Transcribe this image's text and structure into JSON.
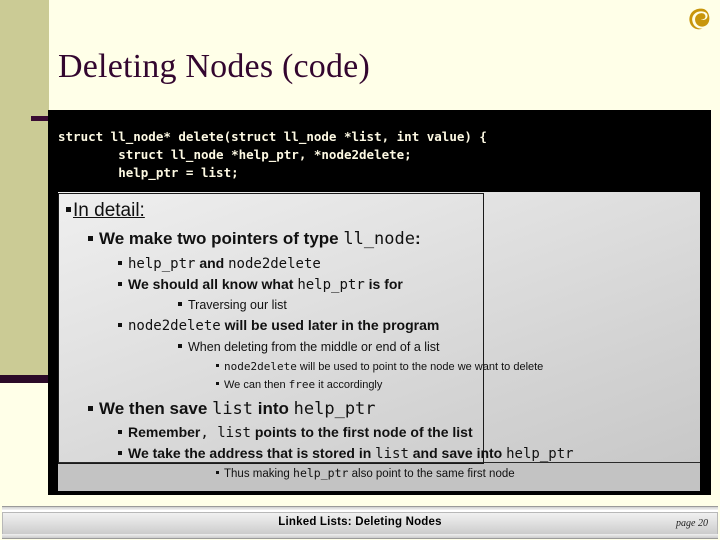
{
  "slide": {
    "title": "Deleting Nodes (code)",
    "logo_icon": "swirl-logo-icon",
    "accent_colors": {
      "title_purple": "#33062f",
      "khaki": "#cbcb95",
      "background_cream": "#ffffe8",
      "code_background": "#000000",
      "code_text": "#fdf9e3",
      "logo_gold": "#c8960c"
    }
  },
  "code_block": {
    "lines": [
      "struct ll_node* delete(struct ll_node *list, int value) {",
      "        struct ll_node *help_ptr, *node2delete;",
      "        help_ptr = list;"
    ],
    "text": "struct ll_node* delete(struct ll_node *list, int value) {\n        struct ll_node *help_ptr, *node2delete;\n        help_ptr = list;"
  },
  "outline": {
    "heading": "In detail:",
    "items": [
      {
        "level": 2,
        "parts": [
          {
            "t": "We make two pointers of type ",
            "m": false
          },
          {
            "t": "ll_node",
            "m": true
          },
          {
            "t": ":",
            "m": false
          }
        ]
      },
      {
        "level": 3,
        "parts": [
          {
            "t": "help_ptr",
            "m": true
          },
          {
            "t": " and ",
            "m": false
          },
          {
            "t": "node2delete",
            "m": true
          }
        ]
      },
      {
        "level": 3,
        "parts": [
          {
            "t": "We should all know what ",
            "m": false
          },
          {
            "t": "help_ptr",
            "m": true
          },
          {
            "t": " is for",
            "m": false
          }
        ]
      },
      {
        "level": 4,
        "parts": [
          {
            "t": "Traversing our list",
            "m": false
          }
        ]
      },
      {
        "level": 3,
        "parts": [
          {
            "t": "node2delete",
            "m": true
          },
          {
            "t": " will be used later in the program",
            "m": false
          }
        ]
      },
      {
        "level": 4,
        "parts": [
          {
            "t": "When deleting from the middle or end of a list",
            "m": false
          }
        ]
      },
      {
        "level": 5,
        "parts": [
          {
            "t": "node2delete",
            "m": true
          },
          {
            "t": " will be used to point to the node we want to delete",
            "m": false
          }
        ]
      },
      {
        "level": 5,
        "parts": [
          {
            "t": "We can then ",
            "m": false
          },
          {
            "t": "free",
            "m": true
          },
          {
            "t": " it accordingly",
            "m": false
          }
        ]
      },
      {
        "level": 2,
        "parts": [
          {
            "t": "We then save ",
            "m": false
          },
          {
            "t": "list",
            "m": true
          },
          {
            "t": " into ",
            "m": false
          },
          {
            "t": "help_ptr",
            "m": true
          }
        ]
      },
      {
        "level": 3,
        "parts": [
          {
            "t": "Remember",
            "m": false
          },
          {
            "t": ", list",
            "m": true
          },
          {
            "t": " points to the first node of the list",
            "m": false
          }
        ]
      },
      {
        "level": 3,
        "parts": [
          {
            "t": "We take the address that is stored in ",
            "m": false
          },
          {
            "t": "list",
            "m": true
          },
          {
            "t": " and save into ",
            "m": false
          },
          {
            "t": "help_ptr",
            "m": true
          }
        ]
      },
      {
        "level": 6,
        "parts": [
          {
            "t": "Thus making ",
            "m": false
          },
          {
            "t": "help_ptr",
            "m": true
          },
          {
            "t": " also point to the same first node",
            "m": false
          }
        ]
      }
    ]
  },
  "footer": {
    "title": "Linked Lists:  Deleting Nodes",
    "page": "page 20"
  }
}
